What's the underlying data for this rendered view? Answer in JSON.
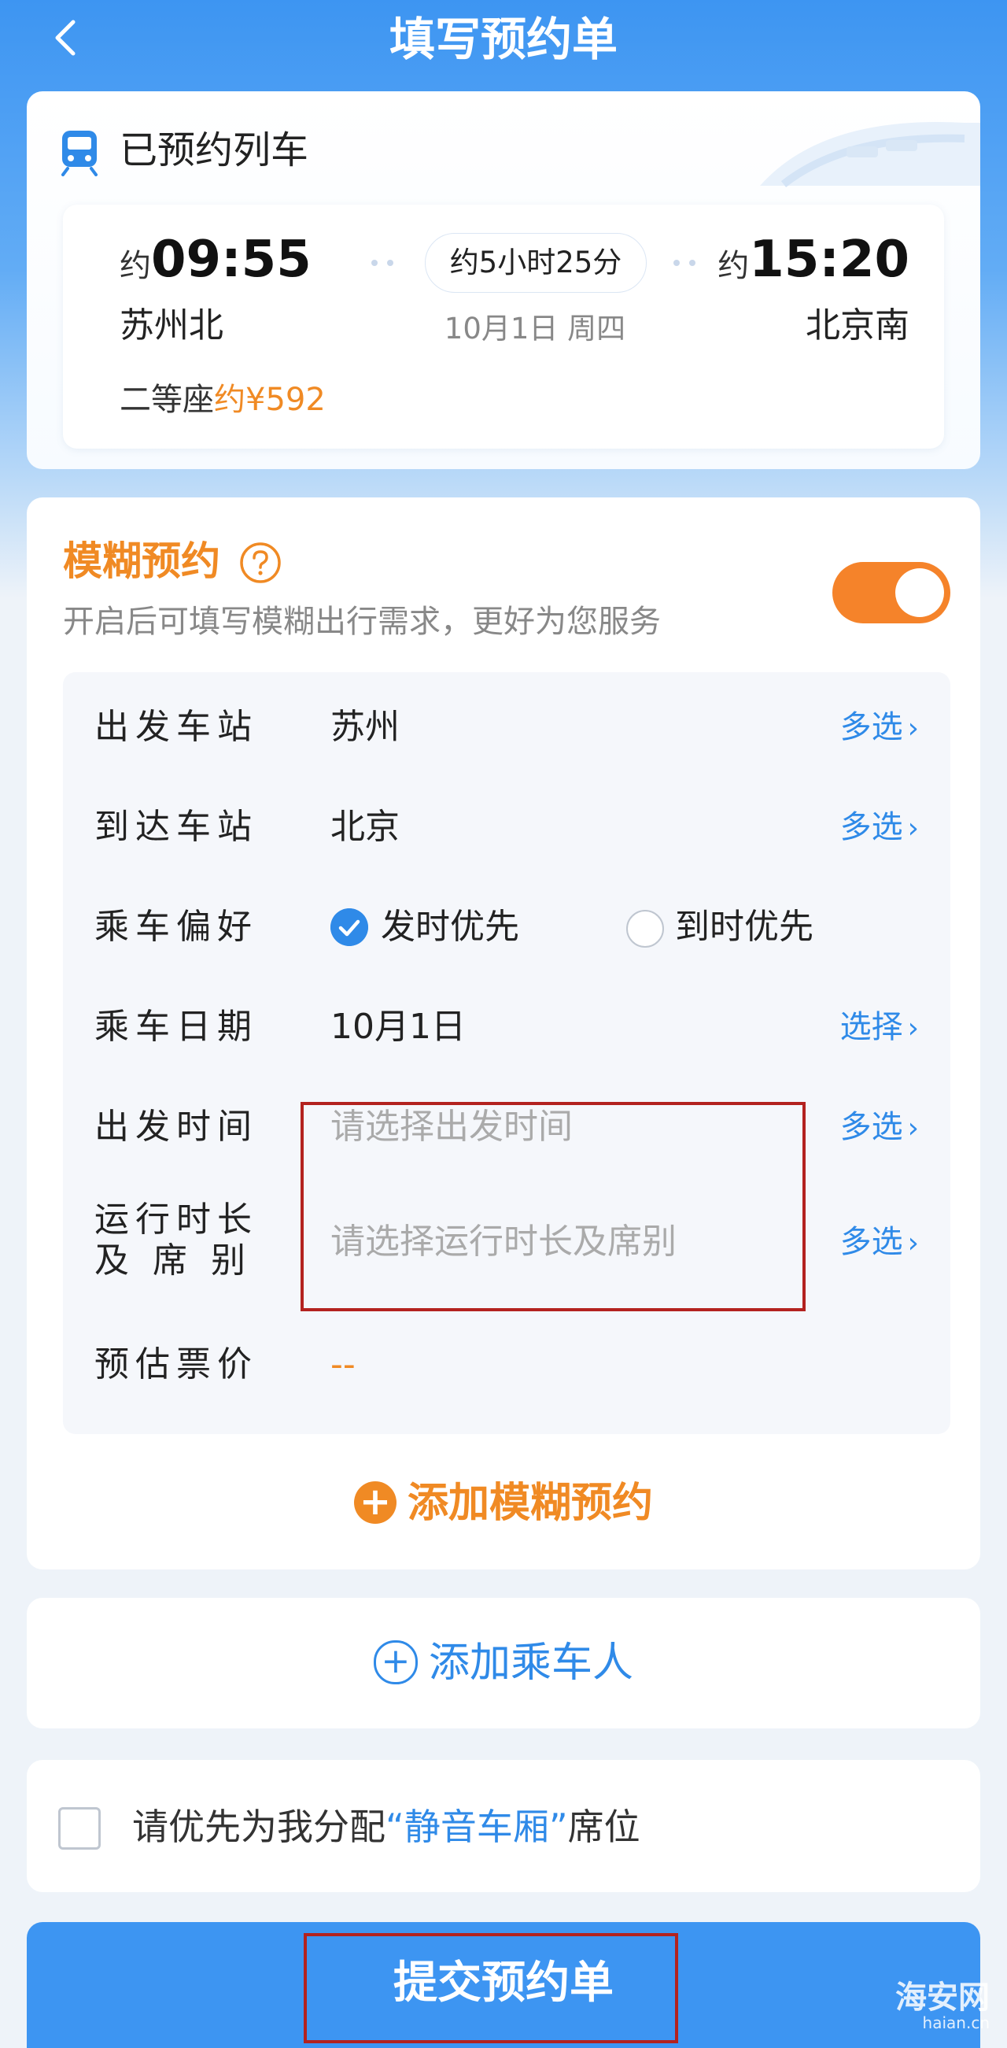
{
  "header": {
    "title": "填写预约单"
  },
  "train": {
    "section_title": "已预约列车",
    "approx": "约",
    "depart_time": "09:55",
    "arrive_time": "15:20",
    "depart_station": "苏州北",
    "arrive_station": "北京南",
    "duration": "约5小时25分",
    "date": "10月1日 周四",
    "seat_class": "二等座",
    "price": "约¥592"
  },
  "fuzzy": {
    "title": "模糊预约",
    "subtitle": "开启后可填写模糊出行需求，更好为您服务",
    "toggle_on": true,
    "rows": {
      "depart_station": {
        "label": "出发车站",
        "value": "苏州",
        "action": "多选"
      },
      "arrive_station": {
        "label": "到达车站",
        "value": "北京",
        "action": "多选"
      },
      "preference": {
        "label": "乘车偏好",
        "option1": "发时优先",
        "option2": "到时优先",
        "selected": "发时优先"
      },
      "date": {
        "label": "乘车日期",
        "value": "10月1日",
        "action": "选择"
      },
      "depart_time": {
        "label": "出发时间",
        "placeholder": "请选择出发时间",
        "action": "多选"
      },
      "duration_seat": {
        "label_line1": "运行时长",
        "label_line2": "及席别",
        "placeholder": "请选择运行时长及席别",
        "action": "多选"
      },
      "est_price": {
        "label": "预估票价",
        "value": "--"
      }
    },
    "add_label": "添加模糊预约"
  },
  "passenger": {
    "add_label": "添加乘车人"
  },
  "quiet": {
    "prefix": "请优先为我分配",
    "highlight": "“静音车厢”",
    "suffix": "席位"
  },
  "submit": {
    "label": "提交预约单"
  },
  "watermark": {
    "main": "海安网",
    "sub": "haian.cn"
  },
  "colors": {
    "primary": "#3d95f2",
    "accent": "#f08a24",
    "link": "#2f8ae8"
  }
}
